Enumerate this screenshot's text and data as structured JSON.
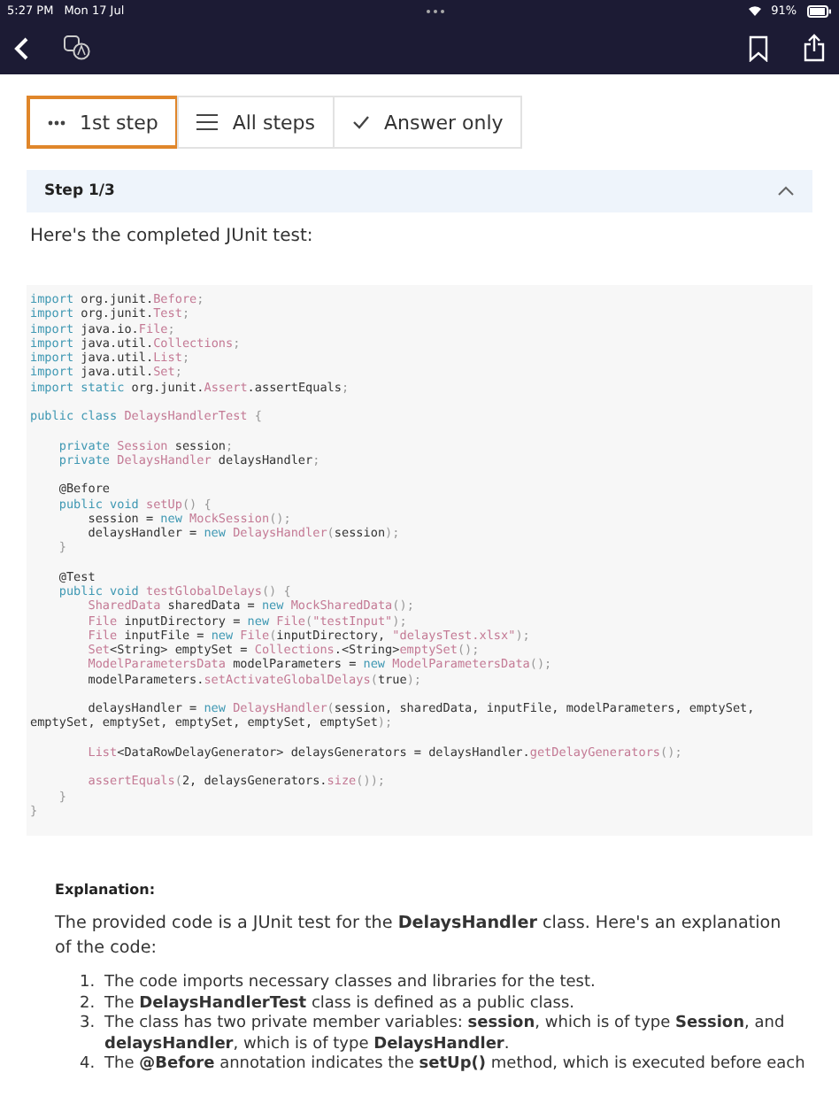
{
  "status_bar": {
    "time": "5:27 PM",
    "date": "Mon 17 Jul",
    "battery": "91%"
  },
  "view_tabs": [
    {
      "label": "1st step",
      "selected": true
    },
    {
      "label": "All steps",
      "selected": false
    },
    {
      "label": "Answer only",
      "selected": false
    }
  ],
  "step": {
    "title": "Step 1/3",
    "expanded": true,
    "intro": "Here's the completed JUnit test:"
  },
  "code_blocks": [
    [
      [
        {
          "kind": "keyword",
          "t": "import"
        },
        {
          "kind": "plain",
          "t": " org.junit."
        },
        {
          "kind": "type",
          "t": "Before"
        },
        {
          "kind": "punct",
          "t": ";"
        }
      ],
      [
        {
          "kind": "keyword",
          "t": "import"
        },
        {
          "kind": "plain",
          "t": " org.junit."
        },
        {
          "kind": "type",
          "t": "Test"
        },
        {
          "kind": "punct",
          "t": ";"
        }
      ],
      [
        {
          "kind": "keyword",
          "t": "import"
        },
        {
          "kind": "plain",
          "t": " java.io."
        },
        {
          "kind": "type",
          "t": "File"
        },
        {
          "kind": "punct",
          "t": ";"
        }
      ],
      [
        {
          "kind": "keyword",
          "t": "import"
        },
        {
          "kind": "plain",
          "t": " java.util."
        },
        {
          "kind": "type",
          "t": "Collections"
        },
        {
          "kind": "punct",
          "t": ";"
        }
      ],
      [
        {
          "kind": "keyword",
          "t": "import"
        },
        {
          "kind": "plain",
          "t": " java.util."
        },
        {
          "kind": "type",
          "t": "List"
        },
        {
          "kind": "punct",
          "t": ";"
        }
      ],
      [
        {
          "kind": "keyword",
          "t": "import"
        },
        {
          "kind": "plain",
          "t": " java.util."
        },
        {
          "kind": "type",
          "t": "Set"
        },
        {
          "kind": "punct",
          "t": ";"
        }
      ],
      [
        {
          "kind": "keyword",
          "t": "import"
        },
        {
          "kind": "keyword",
          "t": " static"
        },
        {
          "kind": "plain",
          "t": " org.junit."
        },
        {
          "kind": "type",
          "t": "Assert"
        },
        {
          "kind": "plain",
          "t": ".assertEquals"
        },
        {
          "kind": "punct",
          "t": ";"
        }
      ]
    ],
    [
      [
        {
          "kind": "keyword",
          "t": "public class"
        },
        {
          "kind": "type",
          "t": " DelaysHandlerTest"
        },
        {
          "kind": "punct",
          "t": " {"
        }
      ]
    ],
    [
      [
        {
          "kind": "keyword",
          "t": "    private"
        },
        {
          "kind": "type",
          "t": " Session"
        },
        {
          "kind": "plain",
          "t": " session"
        },
        {
          "kind": "punct",
          "t": ";"
        }
      ],
      [
        {
          "kind": "keyword",
          "t": "    private"
        },
        {
          "kind": "type",
          "t": " DelaysHandler"
        },
        {
          "kind": "plain",
          "t": " delaysHandler"
        },
        {
          "kind": "punct",
          "t": ";"
        }
      ]
    ],
    [
      [
        {
          "kind": "plain",
          "t": "    @Before"
        }
      ],
      [
        {
          "kind": "keyword",
          "t": "    public void"
        },
        {
          "kind": "type",
          "t": " setUp"
        },
        {
          "kind": "punct",
          "t": "() {"
        }
      ],
      [
        {
          "kind": "plain",
          "t": "        session = "
        },
        {
          "kind": "keyword",
          "t": "new"
        },
        {
          "kind": "type",
          "t": " MockSession"
        },
        {
          "kind": "punct",
          "t": "();"
        }
      ],
      [
        {
          "kind": "plain",
          "t": "        delaysHandler = "
        },
        {
          "kind": "keyword",
          "t": "new"
        },
        {
          "kind": "type",
          "t": " DelaysHandler"
        },
        {
          "kind": "punct",
          "t": "("
        },
        {
          "kind": "plain",
          "t": "session"
        },
        {
          "kind": "punct",
          "t": ");"
        }
      ],
      [
        {
          "kind": "punct",
          "t": "    }"
        }
      ]
    ],
    [
      [
        {
          "kind": "plain",
          "t": "    @Test"
        }
      ],
      [
        {
          "kind": "keyword",
          "t": "    public void"
        },
        {
          "kind": "type",
          "t": " testGlobalDelays"
        },
        {
          "kind": "punct",
          "t": "() {"
        }
      ],
      [
        {
          "kind": "type",
          "t": "        SharedData"
        },
        {
          "kind": "plain",
          "t": " sharedData = "
        },
        {
          "kind": "keyword",
          "t": "new"
        },
        {
          "kind": "type",
          "t": " MockSharedData"
        },
        {
          "kind": "punct",
          "t": "();"
        }
      ],
      [
        {
          "kind": "type",
          "t": "        File"
        },
        {
          "kind": "plain",
          "t": " inputDirectory = "
        },
        {
          "kind": "keyword",
          "t": "new"
        },
        {
          "kind": "type",
          "t": " File"
        },
        {
          "kind": "punct",
          "t": "("
        },
        {
          "kind": "type",
          "t": "\"testInput\""
        },
        {
          "kind": "punct",
          "t": ");"
        }
      ],
      [
        {
          "kind": "type",
          "t": "        File"
        },
        {
          "kind": "plain",
          "t": " inputFile = "
        },
        {
          "kind": "keyword",
          "t": "new"
        },
        {
          "kind": "type",
          "t": " File"
        },
        {
          "kind": "punct",
          "t": "("
        },
        {
          "kind": "plain",
          "t": "inputDirectory, "
        },
        {
          "kind": "type",
          "t": "\"delaysTest.xlsx\""
        },
        {
          "kind": "punct",
          "t": ");"
        }
      ],
      [
        {
          "kind": "type",
          "t": "        Set"
        },
        {
          "kind": "plain",
          "t": "<String> emptySet = "
        },
        {
          "kind": "type",
          "t": "Collections"
        },
        {
          "kind": "plain",
          "t": ".<String>"
        },
        {
          "kind": "type",
          "t": "emptySet"
        },
        {
          "kind": "punct",
          "t": "();"
        }
      ],
      [
        {
          "kind": "type",
          "t": "        ModelParametersData"
        },
        {
          "kind": "plain",
          "t": " modelParameters = "
        },
        {
          "kind": "keyword",
          "t": "new"
        },
        {
          "kind": "type",
          "t": " ModelParametersData"
        },
        {
          "kind": "punct",
          "t": "();"
        }
      ],
      [
        {
          "kind": "plain",
          "t": "        modelParameters."
        },
        {
          "kind": "type",
          "t": "setActivateGlobalDelays"
        },
        {
          "kind": "punct",
          "t": "("
        },
        {
          "kind": "plain",
          "t": "true"
        },
        {
          "kind": "punct",
          "t": ");"
        }
      ]
    ],
    [
      [
        {
          "kind": "plain",
          "t": "        delaysHandler = "
        },
        {
          "kind": "keyword",
          "t": "new"
        },
        {
          "kind": "type",
          "t": " DelaysHandler"
        },
        {
          "kind": "punct",
          "t": "("
        },
        {
          "kind": "plain",
          "t": "session, sharedData, inputFile, modelParameters, emptySet,"
        }
      ],
      [
        {
          "kind": "plain",
          "t": "emptySet, emptySet, emptySet, emptySet, emptySet"
        },
        {
          "kind": "punct",
          "t": ");"
        }
      ]
    ],
    [
      [
        {
          "kind": "type",
          "t": "        List"
        },
        {
          "kind": "plain",
          "t": "<DataRowDelayGenerator> delaysGenerators = delaysHandler."
        },
        {
          "kind": "type",
          "t": "getDelayGenerators"
        },
        {
          "kind": "punct",
          "t": "();"
        }
      ]
    ],
    [
      [
        {
          "kind": "type",
          "t": "        assertEquals"
        },
        {
          "kind": "punct",
          "t": "("
        },
        {
          "kind": "plain",
          "t": "2, delaysGenerators."
        },
        {
          "kind": "type",
          "t": "size"
        },
        {
          "kind": "punct",
          "t": "());"
        }
      ],
      [
        {
          "kind": "punct",
          "t": "    }"
        }
      ],
      [
        {
          "kind": "punct",
          "t": "}"
        }
      ]
    ]
  ],
  "explanation": {
    "heading": "Explanation:",
    "paragraph": "The provided code is a JUnit test for the **DelaysHandler** class. Here's an explanation of the code:",
    "items": [
      {
        "marker": "1.",
        "text": "The code imports necessary classes and libraries for the test."
      },
      {
        "marker": "2.",
        "text": "The **DelaysHandlerTest** class is defined as a public class."
      },
      {
        "marker": "3.",
        "text": "The class has two private member variables: **session**, which is of type **Session**, and **delaysHandler**, which is of type **DelaysHandler**."
      },
      {
        "marker": "4.",
        "text": "The **@Before** annotation indicates the **setUp()** method, which is executed before each"
      }
    ]
  }
}
